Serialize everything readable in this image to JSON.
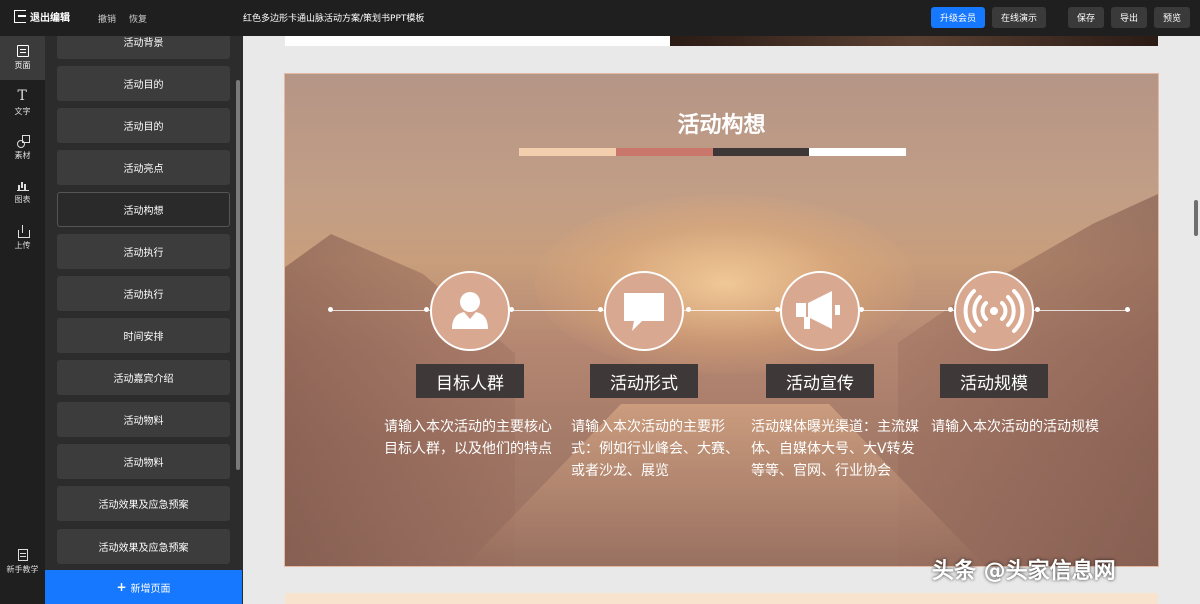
{
  "topbar": {
    "exit_label": "退出编辑",
    "undo_label": "撤销",
    "redo_label": "恢复",
    "doc_title": "红色多边形卡通山脉活动方案/策划书PPT模板",
    "upgrade_label": "升级会员",
    "present_label": "在线演示",
    "save_label": "保存",
    "export_label": "导出",
    "preview_label": "预览"
  },
  "rail": {
    "pages": "页面",
    "text": "文字",
    "material": "素材",
    "chart": "图表",
    "upload": "上传",
    "tutorial": "新手教学"
  },
  "pages": [
    {
      "label": "活动背景"
    },
    {
      "label": "活动目的"
    },
    {
      "label": "活动目的"
    },
    {
      "label": "活动亮点"
    },
    {
      "label": "活动构想"
    },
    {
      "label": "活动执行"
    },
    {
      "label": "活动执行"
    },
    {
      "label": "时间安排"
    },
    {
      "label": "活动嘉宾介绍"
    },
    {
      "label": "活动物料"
    },
    {
      "label": "活动物料"
    },
    {
      "label": "活动效果及应急预案"
    },
    {
      "label": "活动效果及应急预案"
    }
  ],
  "active_page_index": 4,
  "add_page_label": "新增页面",
  "slide": {
    "title": "活动构想",
    "title_bar_colors": [
      "#f3cfae",
      "#c9776a",
      "#3d3837",
      "#ffffff"
    ],
    "items": [
      {
        "label": "目标人群",
        "icon": "user-icon",
        "desc": "请输入本次活动的主要核心目标人群，以及他们的特点"
      },
      {
        "label": "活动形式",
        "icon": "chat-bubble-icon",
        "desc": "请输入本次活动的主要形式：例如行业峰会、大赛、或者沙龙、展览"
      },
      {
        "label": "活动宣传",
        "icon": "megaphone-icon",
        "desc": "活动媒体曝光渠道：主流媒体、自媒体大号、大V转发等等、官网、行业协会"
      },
      {
        "label": "活动规模",
        "icon": "broadcast-icon",
        "desc": "请输入本次活动的活动规模"
      }
    ]
  },
  "watermark": "头条 @头家信息网",
  "colors": {
    "accent": "#1677ff",
    "label_bg": "#3f3838"
  }
}
